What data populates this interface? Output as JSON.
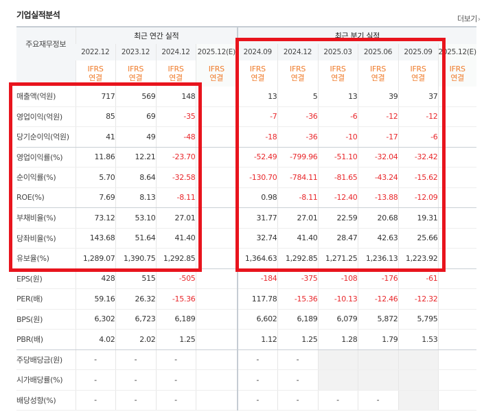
{
  "section_title": "기업실적분석",
  "more_label": "더보기",
  "more_arrow": "›",
  "header": {
    "row_label": "주요재무정보",
    "annual_group": "최근 연간 실적",
    "quarter_group": "최근 분기 실적",
    "periods": [
      "2022.12",
      "2023.12",
      "2024.12",
      "2025.12(E)",
      "2024.09",
      "2024.12",
      "2025.03",
      "2025.06",
      "2025.09",
      "2025.12(E)"
    ],
    "ifrs_line1": "IFRS",
    "ifrs_line2": "연결"
  },
  "rows": [
    {
      "label": "매출액(억원)",
      "values": [
        "717",
        "569",
        "148",
        "",
        "13",
        "5",
        "13",
        "39",
        "37",
        ""
      ]
    },
    {
      "label": "영업이익(억원)",
      "values": [
        "85",
        "69",
        "-35",
        "",
        "-7",
        "-36",
        "-6",
        "-12",
        "-12",
        ""
      ]
    },
    {
      "label": "당기순이익(억원)",
      "values": [
        "41",
        "49",
        "-48",
        "",
        "-18",
        "-36",
        "-10",
        "-17",
        "-6",
        ""
      ]
    },
    {
      "label": "영업이익률(%)",
      "values": [
        "11.86",
        "12.21",
        "-23.70",
        "",
        "-52.49",
        "-799.96",
        "-51.10",
        "-32.04",
        "-32.42",
        ""
      ]
    },
    {
      "label": "순이익률(%)",
      "values": [
        "5.70",
        "8.64",
        "-32.58",
        "",
        "-130.70",
        "-784.11",
        "-81.65",
        "-43.24",
        "-15.62",
        ""
      ]
    },
    {
      "label": "ROE(%)",
      "values": [
        "7.69",
        "8.13",
        "-8.11",
        "",
        "0.98",
        "-8.11",
        "-12.40",
        "-13.88",
        "-12.09",
        ""
      ]
    },
    {
      "label": "부채비율(%)",
      "values": [
        "73.12",
        "53.10",
        "27.01",
        "",
        "31.77",
        "27.01",
        "22.59",
        "20.68",
        "19.31",
        ""
      ]
    },
    {
      "label": "당좌비율(%)",
      "values": [
        "143.68",
        "51.64",
        "41.40",
        "",
        "32.74",
        "41.40",
        "28.47",
        "42.63",
        "25.66",
        ""
      ]
    },
    {
      "label": "유보율(%)",
      "values": [
        "1,289.07",
        "1,390.75",
        "1,292.85",
        "",
        "1,364.63",
        "1,292.85",
        "1,271.25",
        "1,236.13",
        "1,223.92",
        ""
      ]
    },
    {
      "label": "EPS(원)",
      "values": [
        "428",
        "515",
        "-505",
        "",
        "-184",
        "-375",
        "-108",
        "-176",
        "-61",
        ""
      ]
    },
    {
      "label": "PER(배)",
      "values": [
        "59.16",
        "26.32",
        "-15.36",
        "",
        "117.78",
        "-15.36",
        "-10.13",
        "-12.46",
        "-12.32",
        ""
      ]
    },
    {
      "label": "BPS(원)",
      "values": [
        "6,302",
        "6,723",
        "6,189",
        "",
        "6,602",
        "6,189",
        "6,079",
        "5,872",
        "5,795",
        ""
      ]
    },
    {
      "label": "PBR(배)",
      "values": [
        "4.02",
        "2.02",
        "1.25",
        "",
        "1.12",
        "1.25",
        "1.28",
        "1.79",
        "1.53",
        ""
      ]
    },
    {
      "label": "주당배당금(원)",
      "values": [
        "-",
        "-",
        "-",
        "",
        "-",
        "-",
        "",
        "",
        "",
        ""
      ]
    },
    {
      "label": "시가배당률(%)",
      "values": [
        "-",
        "-",
        "-",
        "",
        "-",
        "-",
        "",
        "",
        "",
        ""
      ]
    },
    {
      "label": "배당성향(%)",
      "values": [
        "-",
        "-",
        "-",
        "",
        "-",
        "-",
        "-",
        "-",
        "",
        ""
      ]
    }
  ],
  "colors": {
    "negative": "#e8262a",
    "ifrs": "#ef7b2a",
    "highlight_box": "#e8141d"
  }
}
